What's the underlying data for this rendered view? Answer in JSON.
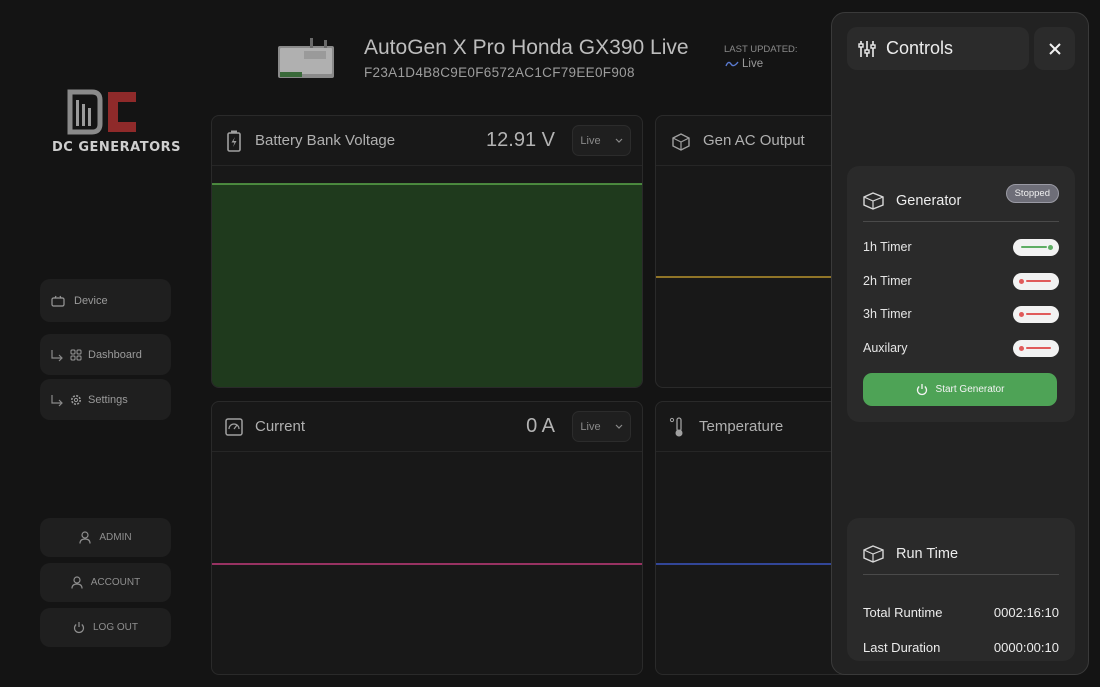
{
  "app": {
    "brand": "DC GENERATORS"
  },
  "sidebar": {
    "nav": [
      {
        "label": "Device",
        "icon": "monitor-icon"
      },
      {
        "label": "Dashboard",
        "icon": "grid-icon"
      },
      {
        "label": "Settings",
        "icon": "gear-icon"
      }
    ],
    "account": [
      {
        "label": "ADMIN",
        "icon": "user-icon"
      },
      {
        "label": "ACCOUNT",
        "icon": "user-icon"
      },
      {
        "label": "LOG OUT",
        "icon": "power-icon"
      }
    ]
  },
  "header": {
    "title": "AutoGen X Pro Honda GX390 Live",
    "device_id": "F23A1D4B8C9E0F6572AC1CF79EE0F908",
    "last_updated_label": "LAST UPDATED:",
    "status": "Live"
  },
  "cards": {
    "battery": {
      "title": "Battery Bank Voltage",
      "value": "12.91 V",
      "select": "Live",
      "color": "#5aa84a"
    },
    "ac_output": {
      "title": "Gen AC Output",
      "color": "#b8922c"
    },
    "current": {
      "title": "Current",
      "value": "0 A",
      "select": "Live",
      "color": "#c23a7a"
    },
    "temperature": {
      "title": "Temperature",
      "color": "#3a56c2"
    }
  },
  "controls": {
    "title": "Controls",
    "generator": {
      "title": "Generator",
      "status": "Stopped",
      "timers": [
        {
          "label": "1h Timer",
          "on": true
        },
        {
          "label": "2h Timer",
          "on": false
        },
        {
          "label": "3h Timer",
          "on": false
        },
        {
          "label": "Auxilary",
          "on": false
        }
      ],
      "start_label": "Start Generator"
    },
    "runtime": {
      "title": "Run Time",
      "total_label": "Total Runtime",
      "total_value": "0002:16:10",
      "last_label": "Last Duration",
      "last_value": "0000:00:10"
    }
  },
  "colors": {
    "accent_green": "#4ea356",
    "toggle_off": "#e05a5a"
  }
}
